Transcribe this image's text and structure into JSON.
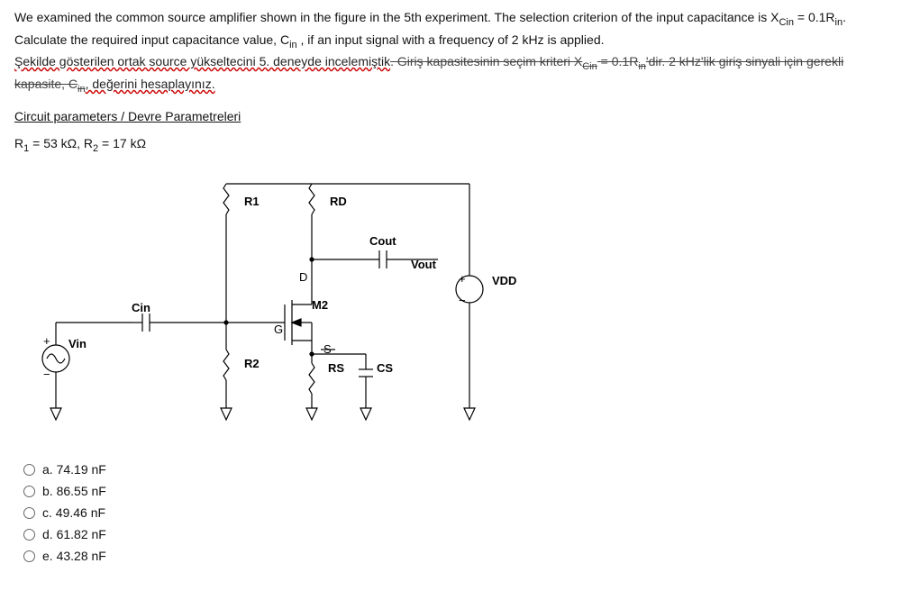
{
  "problem": {
    "line1a": "We examined the common source amplifier shown in the figure in the 5th experiment. The selection criterion of the input capacitance is X",
    "line1_sub": "Cin",
    "line1b": " = 0.1R",
    "line1_sub2": "in",
    "line1c": ".",
    "line2a": "Calculate the required input capacitance value, C",
    "line2_sub": "in",
    "line2b": " , if an input signal with a frequency of 2 kHz is applied.",
    "tr1_a": "Şekilde gösterilen ortak source yükseltecini 5. deneyde incelemiştik",
    "tr1_b": ". Giriş kapasitesinin seçim kriteri X",
    "tr1_sub": "Cin",
    "tr1_c": " = 0.1R",
    "tr1_sub2": "in",
    "tr1_d": "'dir. 2 kHz'lik giriş sinyali için gerekli",
    "tr2_a": "kapasite, C",
    "tr2_sub": "in",
    "tr2_b": ", değerini hesaplayınız.",
    "circuit_params_heading": "Circuit parameters / Devre Parametreleri",
    "r_values_a": "R",
    "r_values_sub1": "1",
    "r_values_b": " = 53 kΩ, R",
    "r_values_sub2": "2",
    "r_values_c": " = 17 kΩ"
  },
  "circuit_labels": {
    "r1": "R1",
    "rd": "RD",
    "cout": "Cout",
    "vout": "Vout",
    "d": "D",
    "vdd": "VDD",
    "m2": "M2",
    "cin": "Cin",
    "g": "G",
    "vin": "Vin",
    "r2": "R2",
    "s": "S",
    "rs": "RS",
    "cs": "CS"
  },
  "options": {
    "a": "a. 74.19 nF",
    "b": "b. 86.55 nF",
    "c": "c. 49.46 nF",
    "d": "d. 61.82 nF",
    "e": "e. 43.28 nF"
  }
}
